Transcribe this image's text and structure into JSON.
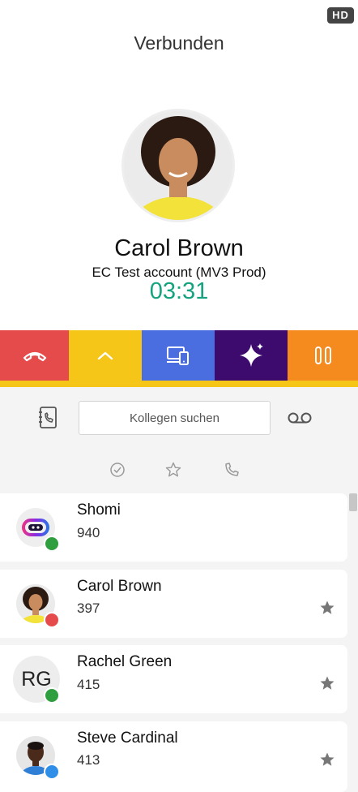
{
  "header": {
    "hd_badge": "HD",
    "status": "Verbunden"
  },
  "caller": {
    "name": "Carol Brown",
    "account": "EC Test account (MV3 Prod)",
    "timer": "03:31"
  },
  "actions": [
    {
      "name": "hangup",
      "icon": "hangup-icon",
      "color": "#e54b4b"
    },
    {
      "name": "expand",
      "icon": "chevron-up-icon",
      "color": "#f5c518"
    },
    {
      "name": "device",
      "icon": "devices-icon",
      "color": "#4a6ee0"
    },
    {
      "name": "ai",
      "icon": "sparkle-icon",
      "color": "#3d0a6e"
    },
    {
      "name": "hold",
      "icon": "pause-icon",
      "color": "#f58a1f"
    }
  ],
  "search": {
    "placeholder": "Kollegen suchen"
  },
  "filters": [
    "check-circle-icon",
    "star-icon",
    "phone-icon"
  ],
  "contacts": [
    {
      "name": "Shomi",
      "ext": "940",
      "presence": "#2e9e3e",
      "avatar": "shomi-logo",
      "favorite": false
    },
    {
      "name": "Carol Brown",
      "ext": "397",
      "presence": "#e54b4b",
      "avatar": "photo",
      "favorite": true
    },
    {
      "name": "Rachel Green",
      "ext": "415",
      "presence": "#2e9e3e",
      "initials": "RG",
      "favorite": true
    },
    {
      "name": "Steve Cardinal",
      "ext": "413",
      "presence": "#2f8ee8",
      "avatar": "photo",
      "favorite": true
    }
  ],
  "colors": {
    "accent_green": "#15a37f",
    "star": "#777777"
  }
}
